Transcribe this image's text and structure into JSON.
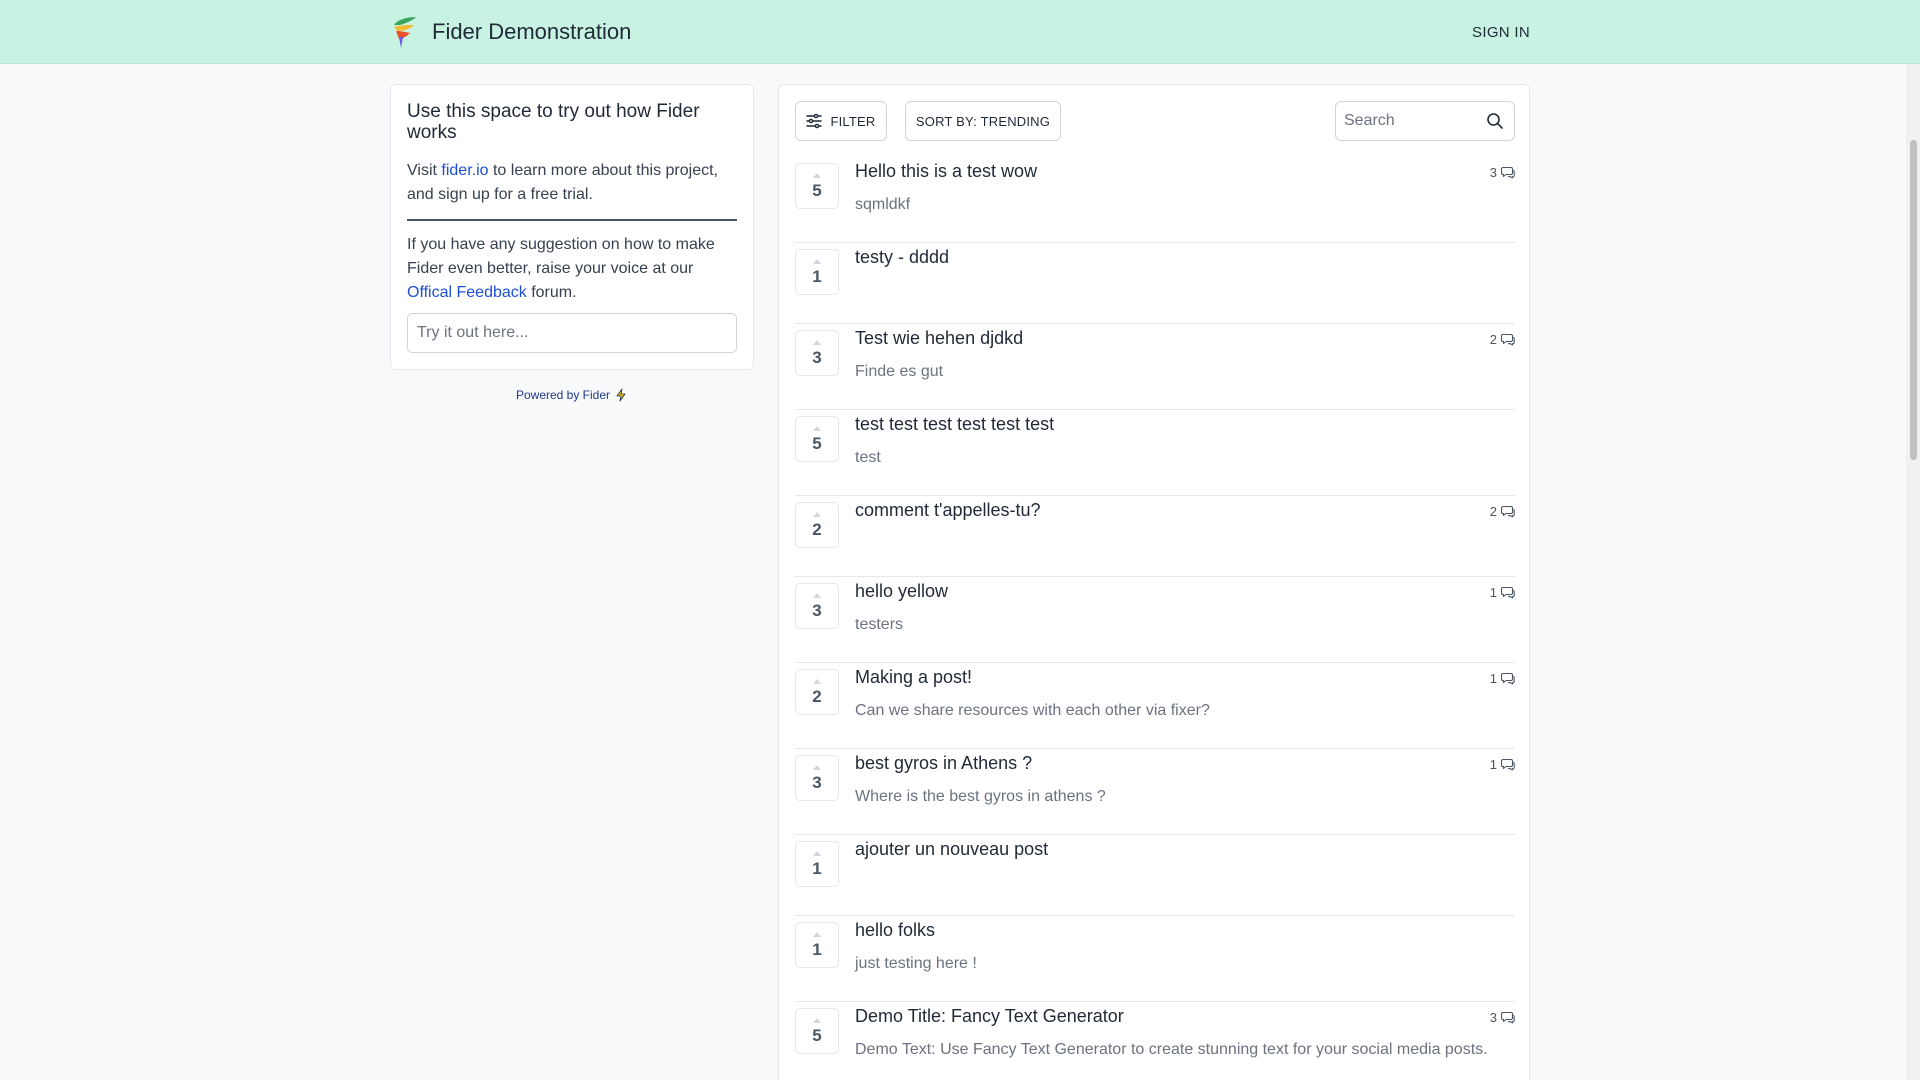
{
  "header": {
    "title": "Fider Demonstration",
    "sign_in": "SIGN IN"
  },
  "sidebar": {
    "title": "Use this space to try out how Fider works",
    "visit_prefix": "Visit ",
    "visit_link": "fider.io",
    "visit_suffix": " to learn more about this project, and sign up for a free trial.",
    "suggest_text": "If you have any suggestion on how to make Fider even better, raise your voice at our ",
    "feedback_link": "Offical Feedback",
    "suggest_suffix": " forum.",
    "input_placeholder": "Try it out here..."
  },
  "powered_by": "Powered by Fider",
  "toolbar": {
    "filter_label": "FILTER",
    "sort_label": "SORT BY: TRENDING",
    "search_placeholder": "Search"
  },
  "posts": [
    {
      "votes": "5",
      "title": "Hello this is a test wow",
      "description": "sqmldkf",
      "comments": "3"
    },
    {
      "votes": "1",
      "title": "testy - dddd",
      "description": "",
      "comments": ""
    },
    {
      "votes": "3",
      "title": "Test wie hehen djdkd",
      "description": "Finde es gut",
      "comments": "2"
    },
    {
      "votes": "5",
      "title": "test test test test test test",
      "description": "test",
      "comments": ""
    },
    {
      "votes": "2",
      "title": "comment t'appelles-tu?",
      "description": "",
      "comments": "2"
    },
    {
      "votes": "3",
      "title": "hello yellow",
      "description": "testers",
      "comments": "1"
    },
    {
      "votes": "2",
      "title": "Making a post!",
      "description": "Can we share resources with each other via fixer?",
      "comments": "1"
    },
    {
      "votes": "3",
      "title": "best gyros in Athens ?",
      "description": "Where is the best gyros in athens ?",
      "comments": "1"
    },
    {
      "votes": "1",
      "title": "ajouter un nouveau post",
      "description": "",
      "comments": ""
    },
    {
      "votes": "1",
      "title": "hello folks",
      "description": "just testing here !",
      "comments": ""
    },
    {
      "votes": "5",
      "title": "Demo Title: Fancy Text Generator",
      "description": "Demo Text: Use Fancy Text Generator to create stunning text for your social media posts.",
      "comments": "3"
    }
  ]
}
